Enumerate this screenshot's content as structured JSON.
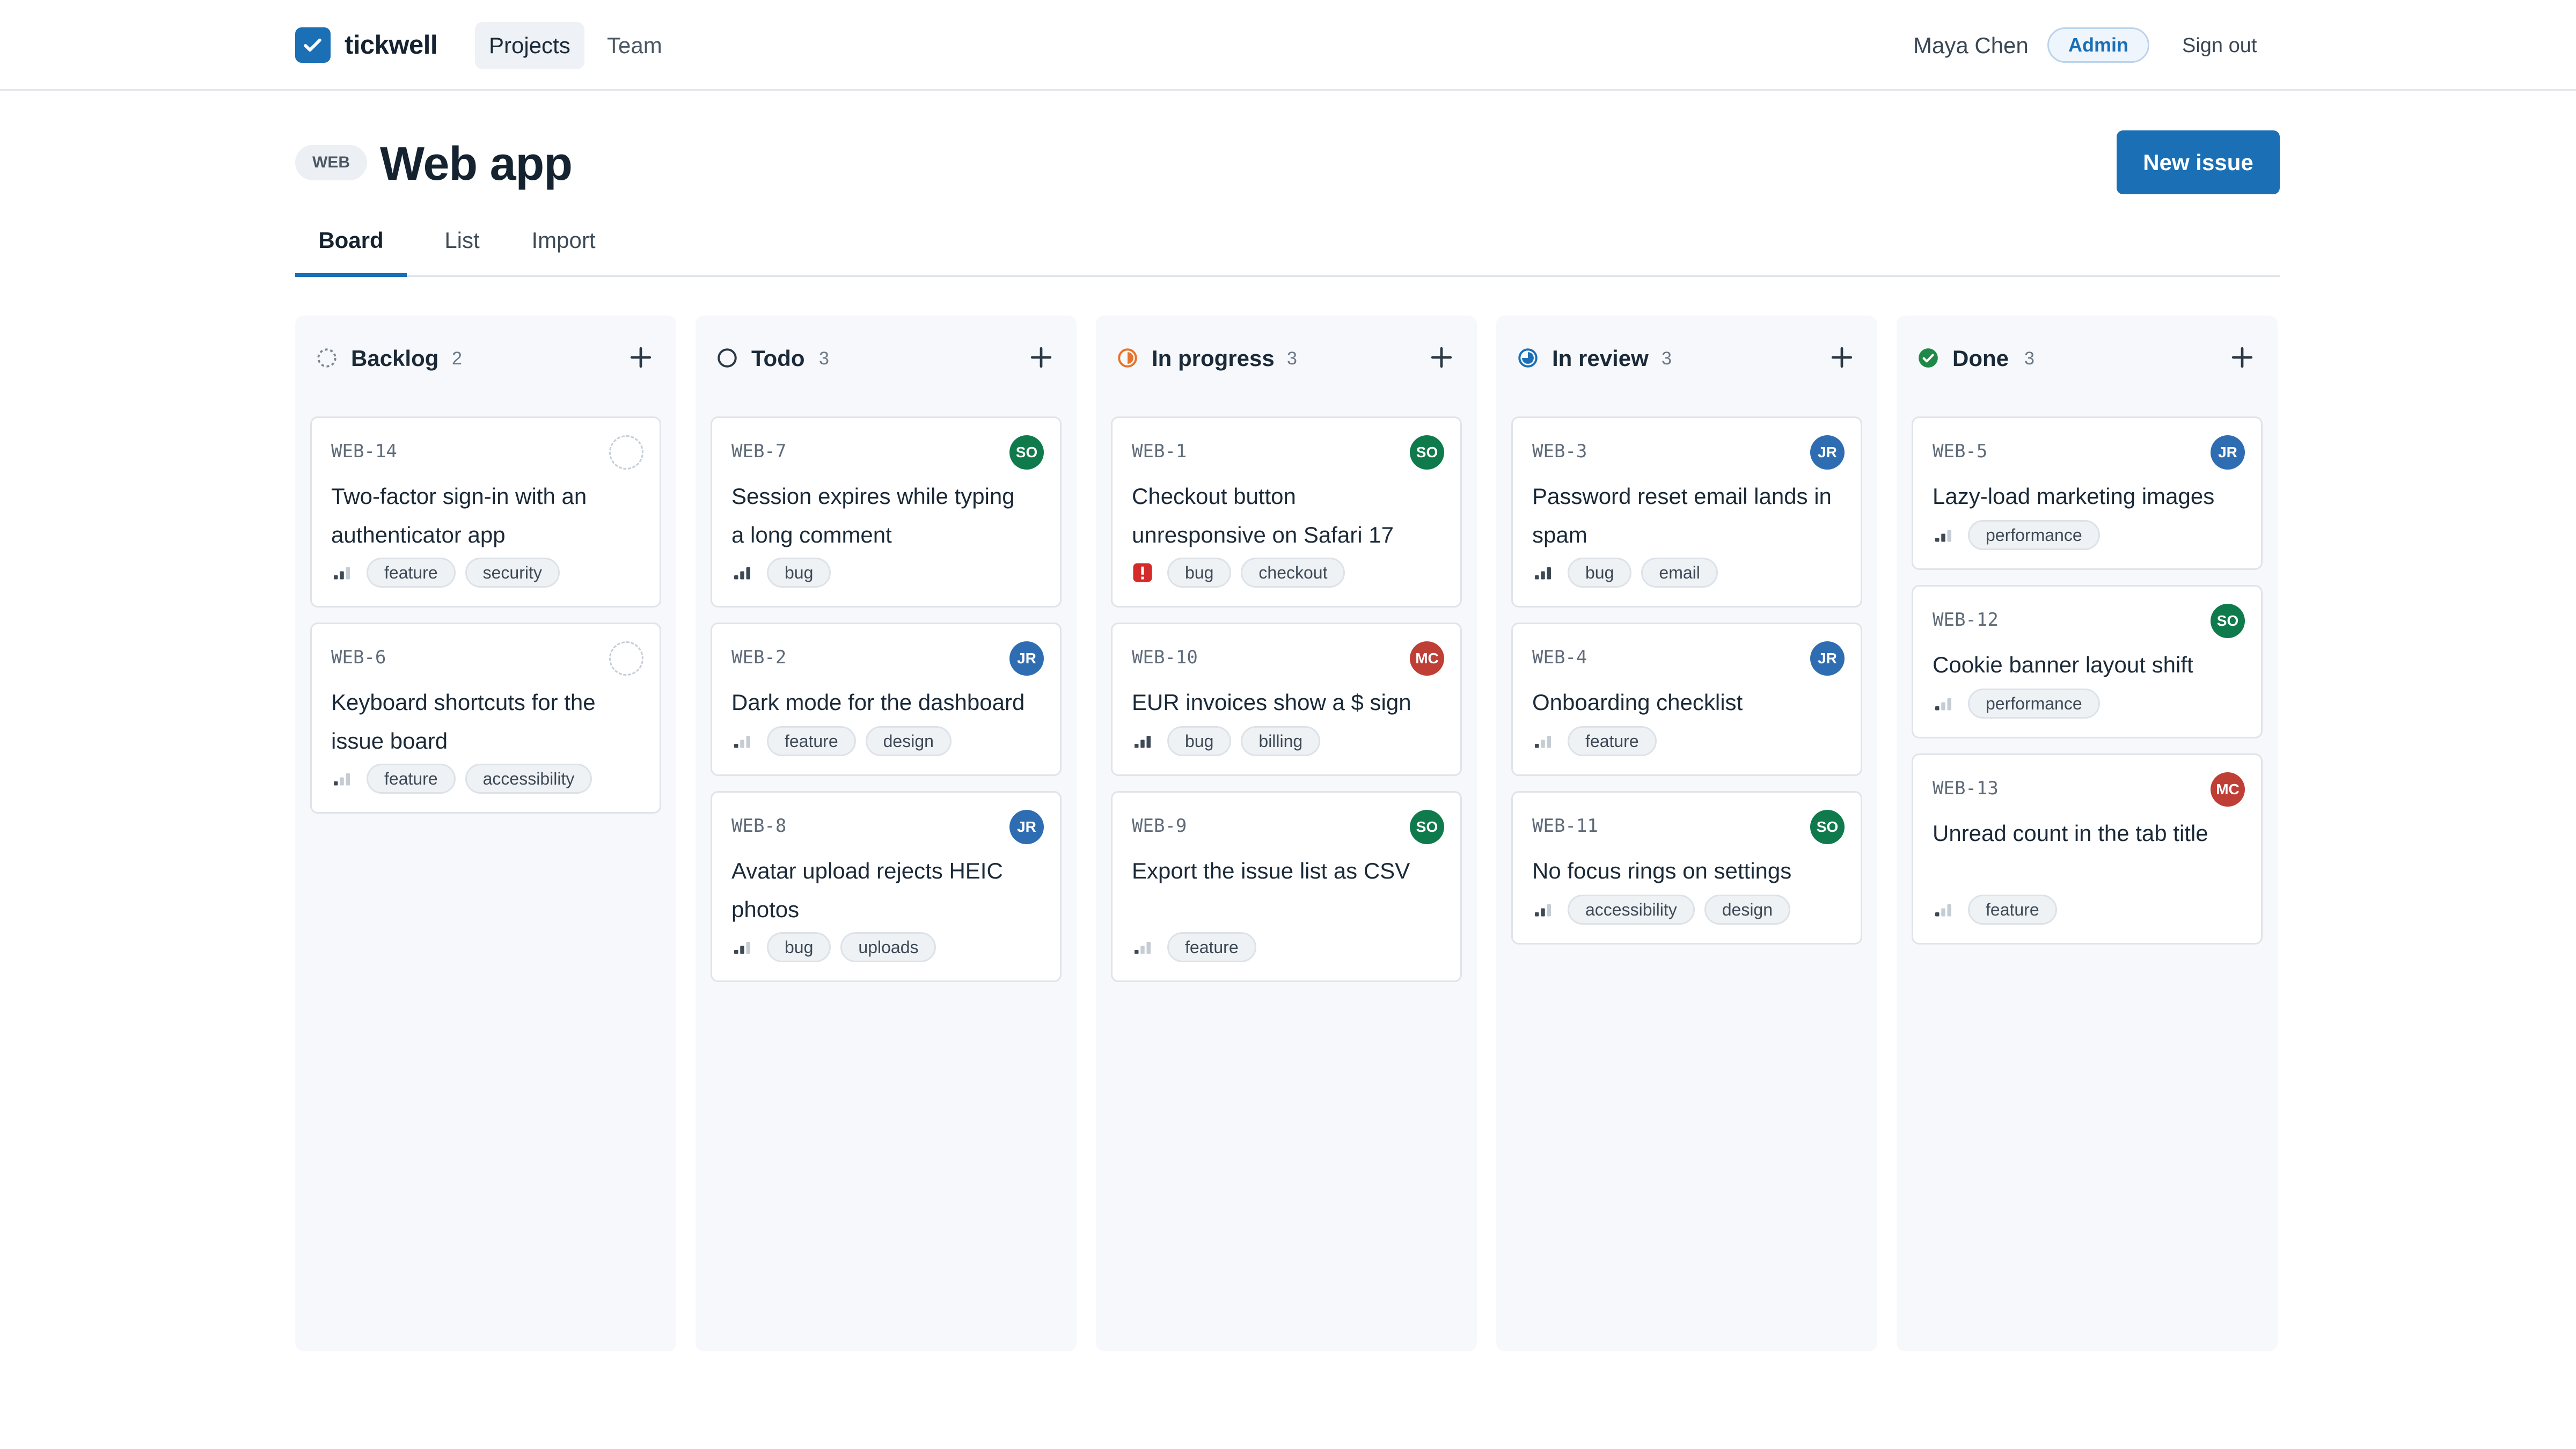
{
  "app": {
    "name": "tickwell",
    "logo_icon": "checkbox-check-icon"
  },
  "nav": {
    "items": [
      {
        "label": "Projects",
        "active": true
      },
      {
        "label": "Team",
        "active": false
      }
    ]
  },
  "user": {
    "name": "Maya Chen",
    "role": "Admin",
    "sign_out": "Sign out"
  },
  "project": {
    "key": "WEB",
    "title": "Web app",
    "new_issue_label": "New issue"
  },
  "tabs": [
    {
      "label": "Board",
      "active": true
    },
    {
      "label": "List",
      "active": false
    },
    {
      "label": "Import",
      "active": false
    }
  ],
  "colors": {
    "accent": "#1a6fb5",
    "in_progress": "#e8742a",
    "in_review": "#1a6fb5",
    "done": "#1f8a47",
    "urgent": "#d42a2a",
    "avatar_SO": "#0f7a4b",
    "avatar_JR": "#2f6db3",
    "avatar_MC": "#bf3e36"
  },
  "columns": [
    {
      "title": "Backlog",
      "count": "2",
      "status_icon": "dashed-circle-icon",
      "cards": [
        {
          "id": "WEB-14",
          "title": "Two-factor sign-in with an authenticator app",
          "assignee": "",
          "priority": "medium",
          "tags": [
            "feature",
            "security"
          ]
        },
        {
          "id": "WEB-6",
          "title": "Keyboard shortcuts for the issue board",
          "assignee": "",
          "priority": "low",
          "tags": [
            "feature",
            "accessibility"
          ]
        }
      ]
    },
    {
      "title": "Todo",
      "count": "3",
      "status_icon": "empty-circle-icon",
      "cards": [
        {
          "id": "WEB-7",
          "title": "Session expires while typing a long comment",
          "assignee": "SO",
          "priority": "high",
          "tags": [
            "bug"
          ]
        },
        {
          "id": "WEB-2",
          "title": "Dark mode for the dashboard",
          "assignee": "JR",
          "priority": "low",
          "tags": [
            "feature",
            "design"
          ]
        },
        {
          "id": "WEB-8",
          "title": "Avatar upload rejects HEIC photos",
          "assignee": "JR",
          "priority": "medium",
          "tags": [
            "bug",
            "uploads"
          ]
        }
      ]
    },
    {
      "title": "In progress",
      "count": "3",
      "status_icon": "half-circle-icon",
      "cards": [
        {
          "id": "WEB-1",
          "title": "Checkout button unresponsive on Safari 17",
          "assignee": "SO",
          "priority": "urgent",
          "tags": [
            "bug",
            "checkout"
          ]
        },
        {
          "id": "WEB-10",
          "title": "EUR invoices show a $ sign",
          "assignee": "MC",
          "priority": "high",
          "tags": [
            "bug",
            "billing"
          ]
        },
        {
          "id": "WEB-9",
          "title": "Export the issue list as CSV",
          "assignee": "SO",
          "priority": "low",
          "tags": [
            "feature"
          ]
        }
      ]
    },
    {
      "title": "In review",
      "count": "3",
      "status_icon": "three-quarter-circle-icon",
      "cards": [
        {
          "id": "WEB-3",
          "title": "Password reset email lands in spam",
          "assignee": "JR",
          "priority": "high",
          "tags": [
            "bug",
            "email"
          ]
        },
        {
          "id": "WEB-4",
          "title": "Onboarding checklist",
          "assignee": "JR",
          "priority": "low",
          "tags": [
            "feature"
          ]
        },
        {
          "id": "WEB-11",
          "title": "No focus rings on settings",
          "assignee": "SO",
          "priority": "medium",
          "tags": [
            "accessibility",
            "design"
          ]
        }
      ]
    },
    {
      "title": "Done",
      "count": "3",
      "status_icon": "check-circle-icon",
      "cards": [
        {
          "id": "WEB-5",
          "title": "Lazy-load marketing images",
          "assignee": "JR",
          "priority": "medium",
          "tags": [
            "performance"
          ]
        },
        {
          "id": "WEB-12",
          "title": "Cookie banner layout shift",
          "assignee": "SO",
          "priority": "low",
          "tags": [
            "performance"
          ]
        },
        {
          "id": "WEB-13",
          "title": "Unread count in the tab title",
          "assignee": "MC",
          "priority": "low",
          "tags": [
            "feature"
          ]
        }
      ]
    }
  ]
}
